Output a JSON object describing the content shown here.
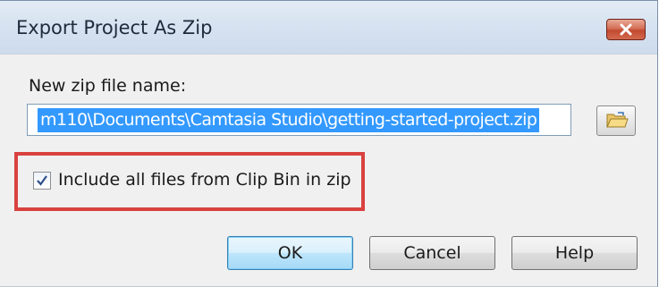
{
  "dialog": {
    "title": "Export Project As Zip",
    "close_icon": "close-icon"
  },
  "zip_name": {
    "label": "New zip file name:",
    "value": "m110\\Documents\\Camtasia Studio\\getting-started-project.zip",
    "browse_icon": "open-folder-icon"
  },
  "include_files": {
    "label": "Include all files from Clip Bin in zip",
    "checked": true
  },
  "buttons": {
    "ok": "OK",
    "cancel": "Cancel",
    "help": "Help"
  },
  "colors": {
    "highlight_border": "#d9413f",
    "selection": "#3399ff",
    "close_button": "#c24a30"
  }
}
